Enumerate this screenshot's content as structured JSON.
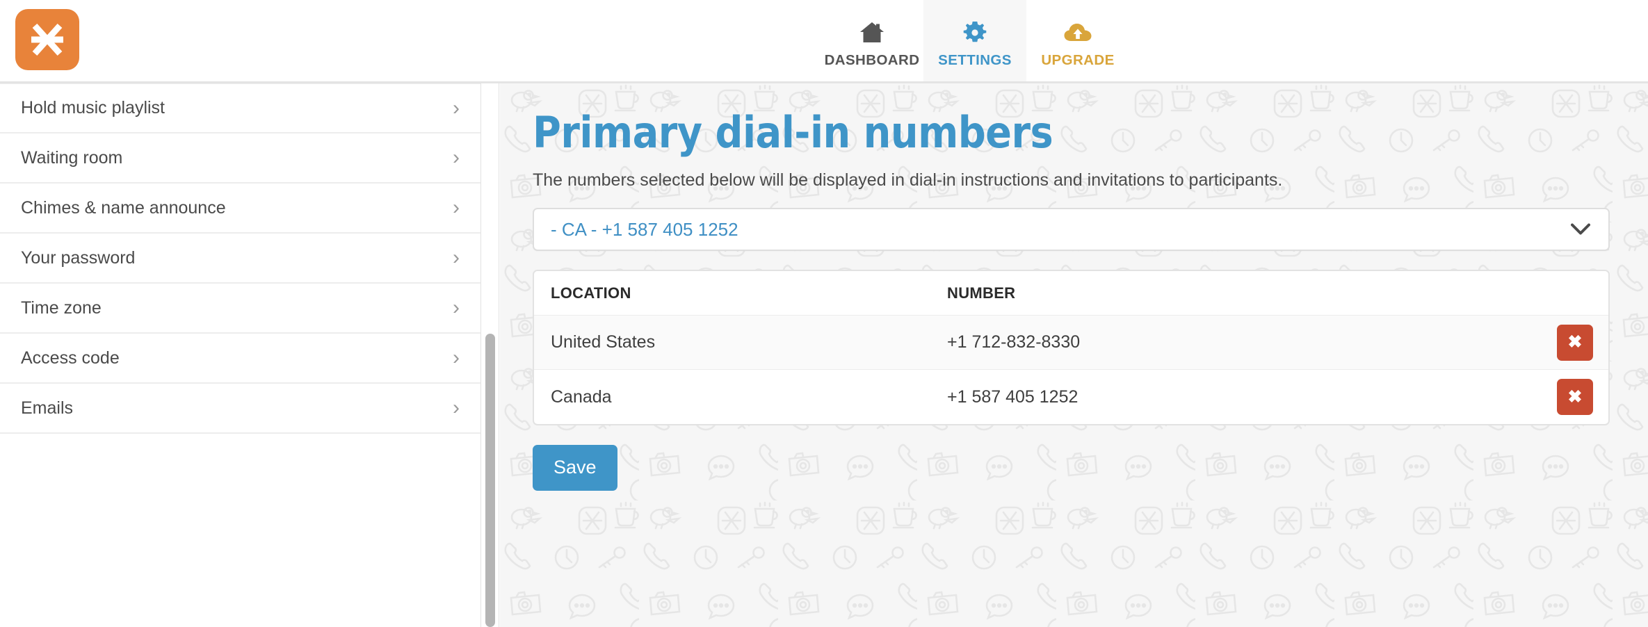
{
  "brand": {
    "logo_icon": "asterisk-logo-icon",
    "logo_color": "#e8833a"
  },
  "header": {
    "nav": [
      {
        "label": "DASHBOARD",
        "icon": "home-icon",
        "color": "#555555",
        "active": false
      },
      {
        "label": "SETTINGS",
        "icon": "gear-icon",
        "color": "#3f95c8",
        "active": true
      },
      {
        "label": "UPGRADE",
        "icon": "cloud-upload-icon",
        "color": "#d9a53b",
        "active": false
      }
    ]
  },
  "sidebar": {
    "items": [
      {
        "label": "Hold music playlist",
        "chevron": "›"
      },
      {
        "label": "Waiting room",
        "chevron": "›"
      },
      {
        "label": "Chimes & name announce",
        "chevron": "›"
      },
      {
        "label": "Your password",
        "chevron": "›"
      },
      {
        "label": "Time zone",
        "chevron": "›"
      },
      {
        "label": "Access code",
        "chevron": "›"
      },
      {
        "label": "Emails",
        "chevron": "›"
      }
    ]
  },
  "main": {
    "title": "Primary dial-in numbers",
    "description": "The numbers selected below will be displayed in dial-in instructions and invitations to participants.",
    "select": {
      "value": "- CA - +1 587 405 1252",
      "caret_icon": "chevron-down-icon"
    },
    "table": {
      "columns": [
        "LOCATION",
        "NUMBER"
      ],
      "rows": [
        {
          "location": "United States",
          "number": "+1 712-832-8330",
          "delete_label": "✖"
        },
        {
          "location": "Canada",
          "number": "+1 587 405 1252",
          "delete_label": "✖"
        }
      ]
    },
    "save_label": "Save"
  },
  "colors": {
    "accent_blue": "#3f95c8",
    "brand_orange": "#e8833a",
    "upgrade_gold": "#d9a53b",
    "delete_red": "#c84b31",
    "main_bg": "#f6f6f6"
  }
}
